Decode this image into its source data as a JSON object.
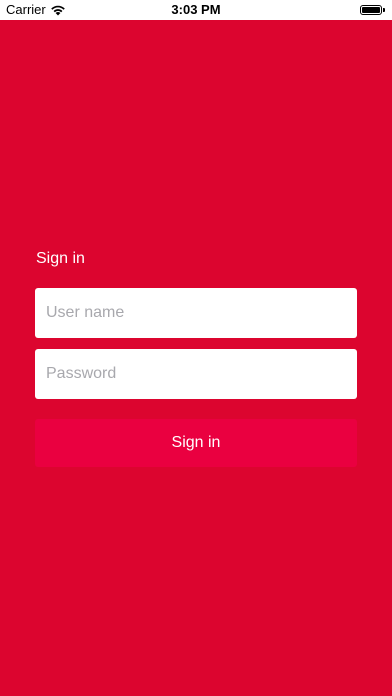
{
  "status_bar": {
    "carrier": "Carrier",
    "time": "3:03 PM",
    "wifi_icon": "wifi-icon",
    "battery_icon": "battery-icon"
  },
  "colors": {
    "background": "#dc052f",
    "button": "#ea0040",
    "field": "#ffffff",
    "placeholder": "#a8a8ad"
  },
  "login": {
    "title": "Sign in",
    "username_placeholder": "User name",
    "password_placeholder": "Password",
    "submit_label": "Sign in"
  }
}
